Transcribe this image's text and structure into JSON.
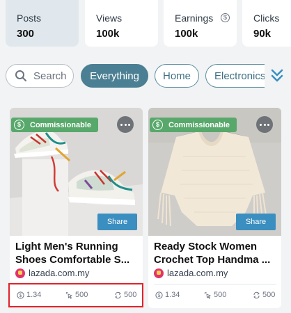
{
  "stats": [
    {
      "label": "Posts",
      "value": "300"
    },
    {
      "label": "Views",
      "value": "100k"
    },
    {
      "label": "Earnings",
      "value": "100k",
      "icon": "dollar-circle-icon"
    },
    {
      "label": "Clicks",
      "value": "90k"
    }
  ],
  "search": {
    "placeholder": "Search"
  },
  "chips": [
    "Everything",
    "Home",
    "Electronics"
  ],
  "colors": {
    "accent": "#4b7f93",
    "badge": "#58a86b",
    "share": "#3b8ec0",
    "highlight": "#e0222a"
  },
  "cards": [
    {
      "badge": "Commissionable",
      "share": "Share",
      "title": "Light Men's Running Shoes Comfortable S...",
      "source": "lazada.com.my",
      "earnings": "1.34",
      "views": "500",
      "shares": "500"
    },
    {
      "badge": "Commissionable",
      "share": "Share",
      "title": "Ready Stock Women Crochet Top Handma ...",
      "source": "lazada.com.my",
      "earnings": "1.34",
      "views": "500",
      "shares": "500"
    }
  ]
}
